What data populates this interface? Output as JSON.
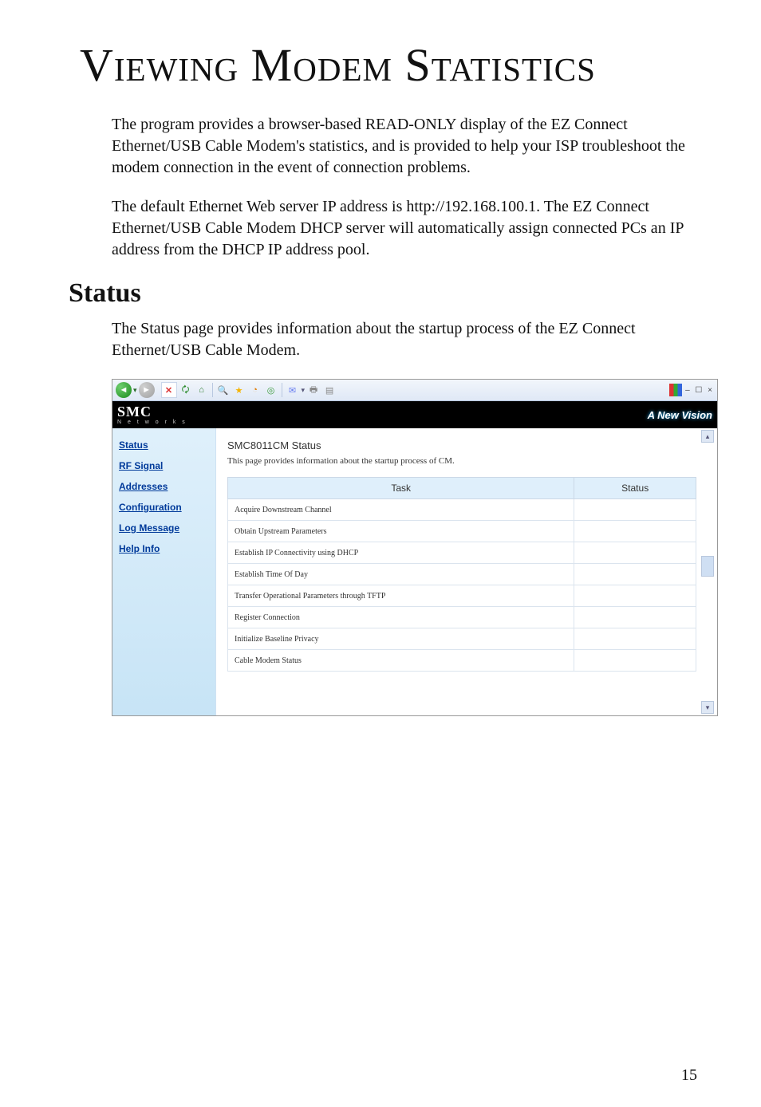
{
  "doc": {
    "title": "Viewing Modem Statistics",
    "para1": "The program provides a browser-based READ-ONLY display of the EZ Connect Ethernet/USB Cable Modem's statistics, and is provided to help your ISP troubleshoot the modem connection in the event of connection problems.",
    "para2": "The default Ethernet Web server IP address is http://192.168.100.1. The EZ Connect Ethernet/USB Cable Modem DHCP server will automatically assign connected PCs an IP address from the DHCP IP address pool.",
    "section_title": "Status",
    "section_intro": "The Status page provides information about the startup process of the EZ Connect Ethernet/USB Cable Modem.",
    "page_number": "15"
  },
  "window": {
    "controls": "–  ☐  ×"
  },
  "brand": {
    "name": "SMC",
    "sub": "N e t w o r k s",
    "tagline": "A New Vision"
  },
  "sidebar": {
    "items": [
      {
        "label": "Status"
      },
      {
        "label": "RF Signal"
      },
      {
        "label": "Addresses"
      },
      {
        "label": "Configuration"
      },
      {
        "label": "Log Message"
      },
      {
        "label": "Help Info"
      }
    ]
  },
  "main": {
    "heading": "SMC8011CM Status",
    "desc": "This page provides information about the startup process of CM.",
    "columns": {
      "task": "Task",
      "status": "Status"
    },
    "rows": [
      {
        "task": "Acquire Downstream Channel",
        "status": ""
      },
      {
        "task": "Obtain Upstream Parameters",
        "status": ""
      },
      {
        "task": "Establish IP Connectivity using DHCP",
        "status": ""
      },
      {
        "task": "Establish Time Of Day",
        "status": ""
      },
      {
        "task": "Transfer Operational Parameters through TFTP",
        "status": ""
      },
      {
        "task": "Register Connection",
        "status": ""
      },
      {
        "task": "Initialize Baseline Privacy",
        "status": ""
      },
      {
        "task": "Cable Modem Status",
        "status": ""
      }
    ]
  }
}
